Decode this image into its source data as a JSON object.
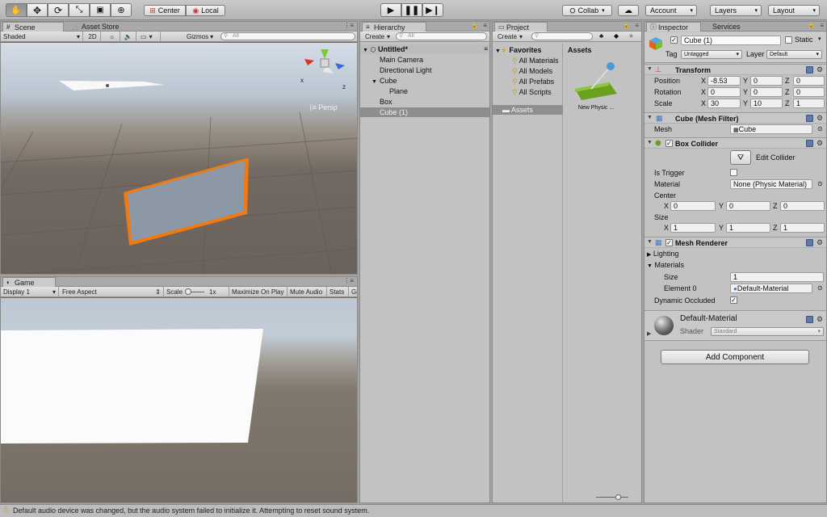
{
  "toolbar": {
    "pivot": "Center",
    "space": "Local",
    "collab": "Collab",
    "account": "Account",
    "layers": "Layers",
    "layout": "Layout"
  },
  "scene": {
    "tabs": [
      "Scene",
      "Asset Store"
    ],
    "shading": "Shaded",
    "mode2d": "2D",
    "gizmos": "Gizmos",
    "search_placeholder": "All",
    "persp": "Persp",
    "axis_x": "x",
    "axis_z": "z"
  },
  "game": {
    "tab": "Game",
    "display": "Display 1",
    "aspect": "Free Aspect",
    "scale_label": "Scale",
    "scale_value": "1x",
    "maximize": "Maximize On Play",
    "mute": "Mute Audio",
    "stats": "Stats",
    "gizmos_short": "Gi"
  },
  "hierarchy": {
    "tab": "Hierarchy",
    "create": "Create",
    "search_placeholder": "All",
    "scene_name": "Untitled*",
    "items": [
      "Main Camera",
      "Directional Light",
      "Cube",
      "Plane",
      "Box",
      "Cube (1)"
    ]
  },
  "project": {
    "tab": "Project",
    "create": "Create",
    "favorites": "Favorites",
    "fav_items": [
      "All Materials",
      "All Models",
      "All Prefabs",
      "All Scripts"
    ],
    "assets_folder": "Assets",
    "assets_header": "Assets",
    "asset_name": "New Physic ..."
  },
  "inspector": {
    "tabs": [
      "Inspector",
      "Services"
    ],
    "object_name": "Cube (1)",
    "static_label": "Static",
    "tag_label": "Tag",
    "tag_value": "Untagged",
    "layer_label": "Layer",
    "layer_value": "Default",
    "transform": {
      "title": "Transform",
      "rows": [
        {
          "label": "Position",
          "x": "-8.53",
          "y": "0",
          "z": "0"
        },
        {
          "label": "Rotation",
          "x": "0",
          "y": "0",
          "z": "0"
        },
        {
          "label": "Scale",
          "x": "30",
          "y": "10",
          "z": "1"
        }
      ]
    },
    "mesh_filter": {
      "title": "Cube (Mesh Filter)",
      "mesh_label": "Mesh",
      "mesh_value": "Cube"
    },
    "box_collider": {
      "title": "Box Collider",
      "edit": "Edit Collider",
      "is_trigger": "Is Trigger",
      "material_label": "Material",
      "material_value": "None (Physic Material)",
      "center_label": "Center",
      "center": {
        "x": "0",
        "y": "0",
        "z": "0"
      },
      "size_label": "Size",
      "size": {
        "x": "1",
        "y": "1",
        "z": "1"
      }
    },
    "mesh_renderer": {
      "title": "Mesh Renderer",
      "lighting": "Lighting",
      "materials": "Materials",
      "size_label": "Size",
      "size_value": "1",
      "element_label": "Element 0",
      "element_value": "Default-Material",
      "dynamic_occluded": "Dynamic Occluded"
    },
    "material": {
      "name": "Default-Material",
      "shader_label": "Shader",
      "shader_value": "Standard"
    },
    "add_component": "Add Component"
  },
  "status": {
    "message": "Default audio device was changed, but the audio system failed to initialize it. Attempting to reset sound system."
  },
  "axes": {
    "x": "X",
    "y": "Y",
    "z": "Z"
  }
}
